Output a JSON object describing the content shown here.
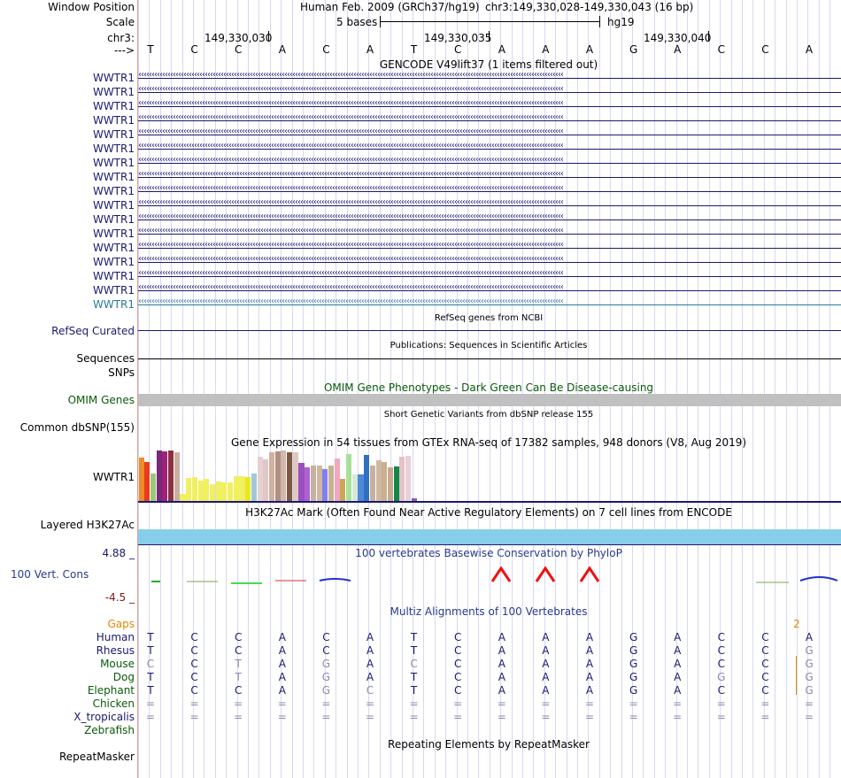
{
  "header": {
    "window_position_label": "Window Position",
    "scale_label": "Scale",
    "chrom_label": "chr3:",
    "strand_label": "--->",
    "assembly": "Human Feb. 2009 (GRCh37/hg19)",
    "position": "chr3:149,330,028-149,330,043 (16 bp)",
    "scale_text": "5 bases",
    "db": "hg19",
    "coord1": "149,330,030",
    "coord2": "149,330,035",
    "coord3": "149,330,040",
    "bases": [
      "T",
      "C",
      "C",
      "A",
      "C",
      "A",
      "T",
      "C",
      "A",
      "A",
      "A",
      "G",
      "A",
      "C",
      "C",
      "A"
    ]
  },
  "gencode": {
    "title": "GENCODE V49lift37 (1 items filtered out)",
    "gene_labels": [
      "WWTR1",
      "WWTR1",
      "WWTR1",
      "WWTR1",
      "WWTR1",
      "WWTR1",
      "WWTR1",
      "WWTR1",
      "WWTR1",
      "WWTR1",
      "WWTR1",
      "WWTR1",
      "WWTR1",
      "WWTR1",
      "WWTR1",
      "WWTR1",
      "WWTR1"
    ],
    "colors": {
      "main": "#1a1a70",
      "last": "#2a7a9a"
    }
  },
  "refseq": {
    "title": "RefSeq genes from NCBI",
    "label": "RefSeq Curated",
    "color": "#1a1a70"
  },
  "pubs": {
    "title": "Publications: Sequences in Scientific Articles",
    "label": "Sequences"
  },
  "snps_label": "SNPs",
  "omim": {
    "title": "OMIM Gene Phenotypes - Dark Green Can Be Disease-causing",
    "label": "OMIM Genes",
    "color": "#0a5a0a"
  },
  "dbsnp": {
    "title": "Short Genetic Variants from dbSNP release 155",
    "label": "Common dbSNP(155)"
  },
  "gtex": {
    "title": "Gene Expression in 54 tissues from GTEx RNA-seq of 17382 samples, 948 donors (V8, Aug 2019)",
    "label": "WWTR1",
    "bar_colors": [
      "#f08c28",
      "#e83c20",
      "#98c878",
      "#7a2878",
      "#a0207a",
      "#8a3040",
      "#c8b0a0",
      "#f0f060",
      "#f0f060",
      "#f0f060",
      "#f0f060",
      "#f0f060",
      "#f0f060",
      "#f0f060",
      "#f0f060",
      "#f0f060",
      "#f0f060",
      "#f0f060",
      "#e8e820",
      "#a0c8d8",
      "#e8d0d0",
      "#e0c8c8",
      "#d0b0a0",
      "#b09080",
      "#d0b8b0",
      "#7a5a40",
      "#e0c8c0",
      "#9a50c0",
      "#b060d0",
      "#c8b0a0",
      "#d0b8a0",
      "#8080f0",
      "#c8b090",
      "#f0a8c0",
      "#c8a858",
      "#a8e098",
      "#d8e8d8",
      "#5088d8",
      "#3070c0",
      "#c8b0a0",
      "#d0b8a0",
      "#c8b090",
      "#c8a890",
      "#108848",
      "#e8c0c8",
      "#e8d0d8",
      "#9a50c0"
    ],
    "bar_values": [
      0.86,
      0.78,
      0.54,
      1.0,
      0.98,
      1.0,
      0.97,
      0.14,
      0.45,
      0.47,
      0.4,
      0.43,
      0.33,
      0.39,
      0.36,
      0.37,
      0.49,
      0.5,
      0.47,
      0.54,
      0.88,
      0.82,
      0.97,
      0.99,
      1.0,
      0.97,
      0.97,
      0.75,
      0.66,
      0.7,
      0.7,
      0.64,
      0.7,
      0.84,
      0.43,
      0.93,
      0.52,
      0.52,
      0.91,
      0.7,
      0.81,
      0.78,
      0.67,
      0.68,
      0.88,
      0.89,
      0.05
    ]
  },
  "h3k27ac": {
    "title": "H3K27Ac Mark (Often Found Near Active Regulatory Elements) on 7 cell lines from ENCODE",
    "label": "Layered H3K27Ac",
    "color": "#87ceeb"
  },
  "phylop": {
    "title": "100 vertebrates Basewise Conservation by PhyloP",
    "label": "100 Vert. Cons",
    "max": "4.88 _",
    "min": "-4.5 _"
  },
  "multiz": {
    "title": "Multiz Alignments of 100 Vertebrates",
    "gaps_label": "Gaps",
    "gaps_value": "2",
    "species": [
      {
        "name": "Human",
        "color": "#1a1a70",
        "seq": [
          "T",
          "C",
          "C",
          "A",
          "C",
          "A",
          "T",
          "C",
          "A",
          "A",
          "A",
          "G",
          "A",
          "C",
          "C",
          "A"
        ]
      },
      {
        "name": "Rhesus",
        "color": "#1a1a70",
        "seq": [
          "T",
          "C",
          "C",
          "A",
          "C",
          "A",
          "T",
          "C",
          "A",
          "A",
          "A",
          "G",
          "A",
          "C",
          "C",
          "G"
        ]
      },
      {
        "name": "Mouse",
        "color": "#0a5a0a",
        "seq": [
          "C",
          "C",
          "T",
          "A",
          "G",
          "A",
          "C",
          "C",
          "A",
          "A",
          "A",
          "G",
          "A",
          "C",
          "C",
          "G"
        ]
      },
      {
        "name": "Dog",
        "color": "#0a5a0a",
        "seq": [
          "T",
          "C",
          "T",
          "A",
          "G",
          "A",
          "T",
          "C",
          "A",
          "A",
          "A",
          "G",
          "A",
          "G",
          "C",
          "G"
        ]
      },
      {
        "name": "Elephant",
        "color": "#0a5a0a",
        "seq": [
          "T",
          "C",
          "C",
          "A",
          "G",
          "C",
          "T",
          "C",
          "A",
          "A",
          "A",
          "G",
          "A",
          "C",
          "C",
          "G"
        ]
      },
      {
        "name": "Chicken",
        "color": "#0a5a0a",
        "seq": [
          "=",
          "=",
          "=",
          "=",
          "=",
          "=",
          "=",
          "=",
          "=",
          "=",
          "=",
          "=",
          "=",
          "=",
          "=",
          "="
        ]
      },
      {
        "name": "X_tropicalis",
        "color": "#1a1a70",
        "seq": [
          "=",
          "=",
          "=",
          "=",
          "=",
          "=",
          "=",
          "=",
          "=",
          "=",
          "=",
          "=",
          "=",
          "=",
          "=",
          "="
        ]
      },
      {
        "name": "Zebrafish",
        "color": "#0a5a0a",
        "seq": []
      }
    ],
    "dim_map": {
      "Rhesus": [
        15
      ],
      "Mouse": [
        0,
        2,
        4,
        6,
        15
      ],
      "Dog": [
        2,
        4,
        13,
        15
      ],
      "Elephant": [
        4,
        5,
        15
      ]
    }
  },
  "repeatmasker": {
    "title": "Repeating Elements by RepeatMasker",
    "label": "RepeatMasker"
  }
}
